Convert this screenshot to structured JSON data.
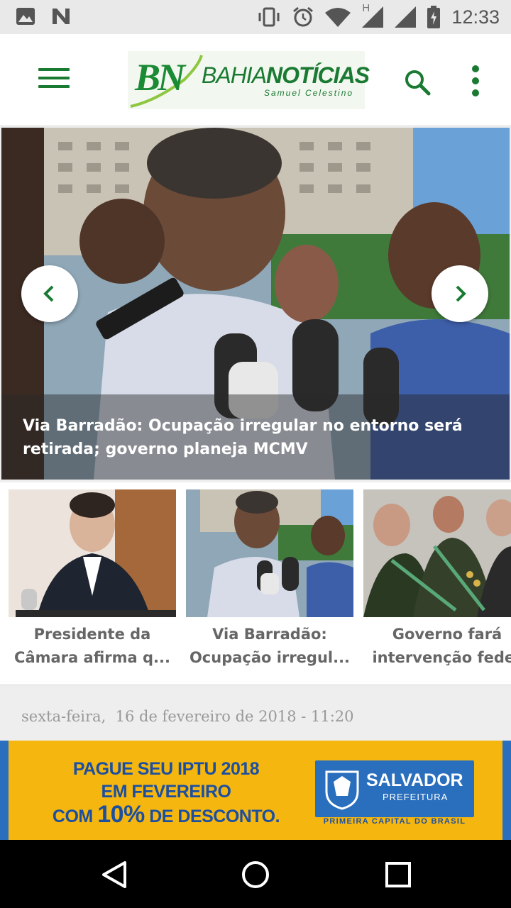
{
  "status_bar": {
    "time": "12:33",
    "left_icons": [
      "image-icon",
      "n-app-icon"
    ],
    "right_icons": [
      "vibrate-icon",
      "alarm-icon",
      "wifi-icon",
      "signal-icon",
      "battery-icon"
    ],
    "network_label": "H"
  },
  "app_bar": {
    "logo_mark": "BN",
    "logo_name_light": "BAHIA",
    "logo_name_bold": "NOTÍCIAS",
    "logo_subtitle": "Samuel Celestino",
    "icons": [
      "menu-icon",
      "search-icon",
      "more-vert-icon"
    ],
    "brand_color": "#1a7a32"
  },
  "hero": {
    "title_line1": "Via Barradão: Ocupação irregular no entorno será",
    "title_line2": "retirada; governo planeja MCMV",
    "prev_icon": "chevron-left-icon",
    "next_icon": "chevron-right-icon"
  },
  "cards": [
    {
      "line1": "Presidente da",
      "line2": "Câmara afirma q..."
    },
    {
      "line1": "Via Barradão:",
      "line2": "Ocupação irregul..."
    },
    {
      "line1": "Governo fará",
      "line2": "intervenção feder"
    }
  ],
  "date_line": "sexta-feira,  16 de fevereiro de 2018 - 11:20",
  "ad": {
    "line1": "PAGUE SEU IPTU 2018",
    "line2": "EM FEVEREIRO",
    "line3_pre": "COM ",
    "line3_big": "10%",
    "line3_post": " DE DESCONTO.",
    "brand": "SALVADOR",
    "brand_sub": "PREFEITURA",
    "tagline": "PRIMEIRA CAPITAL DO BRASIL"
  },
  "nav_bar": {
    "icons": [
      "back-icon",
      "home-icon",
      "recents-icon"
    ]
  }
}
